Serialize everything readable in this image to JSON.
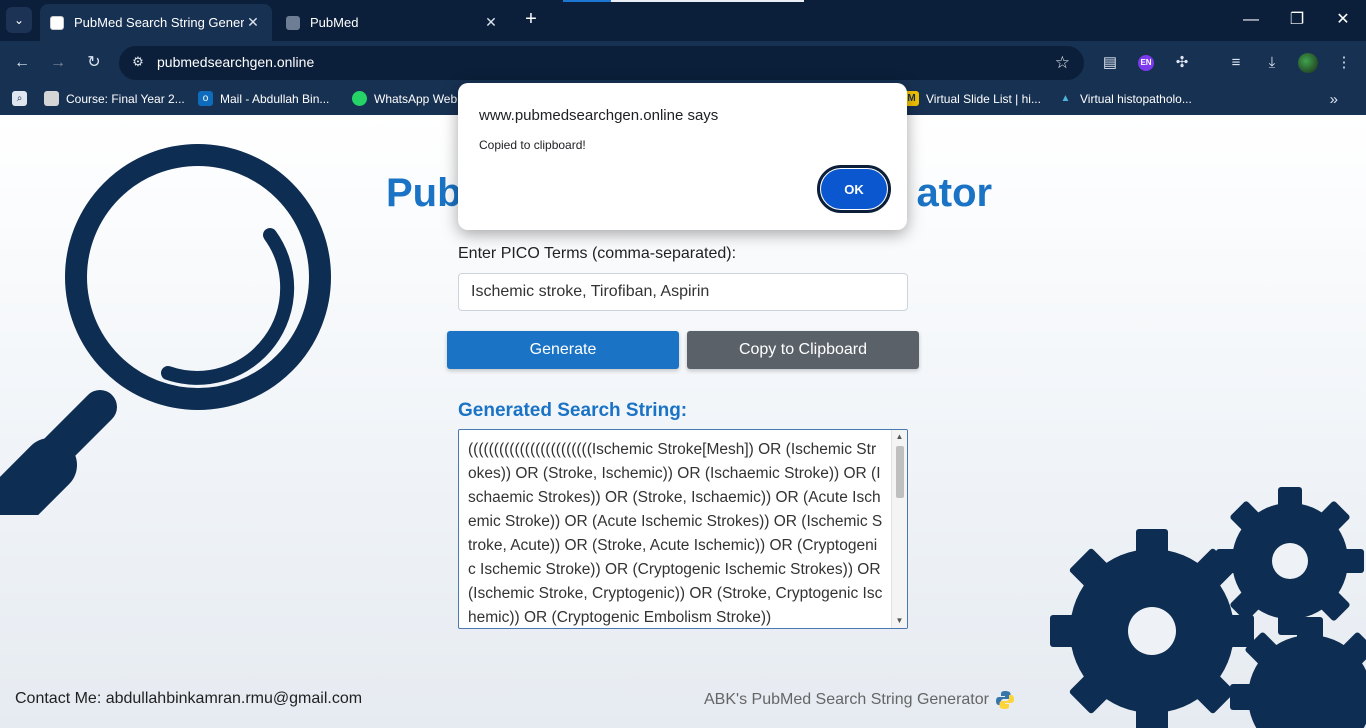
{
  "browser": {
    "tabs": [
      {
        "title": "PubMed Search String Generator"
      },
      {
        "title": "PubMed"
      }
    ],
    "url": "pubmedsearchgen.online",
    "bookmarks": [
      {
        "label": "Course: Final Year 2..."
      },
      {
        "label": "Mail - Abdullah Bin..."
      },
      {
        "label": "WhatsApp Web"
      },
      {
        "label": "Virtual Slide List | hi..."
      },
      {
        "label": "Virtual histopatholo..."
      }
    ],
    "extension_en": "EN"
  },
  "page": {
    "heading_left": "Pub",
    "heading_right": "ator",
    "input_label": "Enter PICO Terms (comma-separated):",
    "input_value": "Ischemic stroke, Tirofiban, Aspirin",
    "generate_label": "Generate",
    "copy_label": "Copy to Clipboard",
    "output_heading": "Generated Search String:",
    "output_text": "((((((((((((((((((((((((Ischemic Stroke[Mesh]) OR (Ischemic Strokes)) OR (Stroke, Ischemic)) OR (Ischaemic Stroke)) OR (Ischaemic Strokes)) OR (Stroke, Ischaemic)) OR (Acute Ischemic Stroke)) OR (Acute Ischemic Strokes)) OR (Ischemic Stroke, Acute)) OR (Stroke, Acute Ischemic)) OR (Cryptogenic Ischemic Stroke)) OR (Cryptogenic Ischemic Strokes)) OR (Ischemic Stroke, Cryptogenic)) OR (Stroke, Cryptogenic Ischemic)) OR (Cryptogenic Embolism Stroke))",
    "footer_contact": "Contact Me: abdullahbinkamran.rmu@gmail.com",
    "footer_brand": "ABK's PubMed Search String Generator"
  },
  "dialog": {
    "title": "www.pubmedsearchgen.online says",
    "message": "Copied to clipboard!",
    "ok_label": "OK"
  },
  "colors": {
    "accent": "#1a73c4",
    "dark_navy": "#0e2d52",
    "copy_button": "#5a6168"
  }
}
